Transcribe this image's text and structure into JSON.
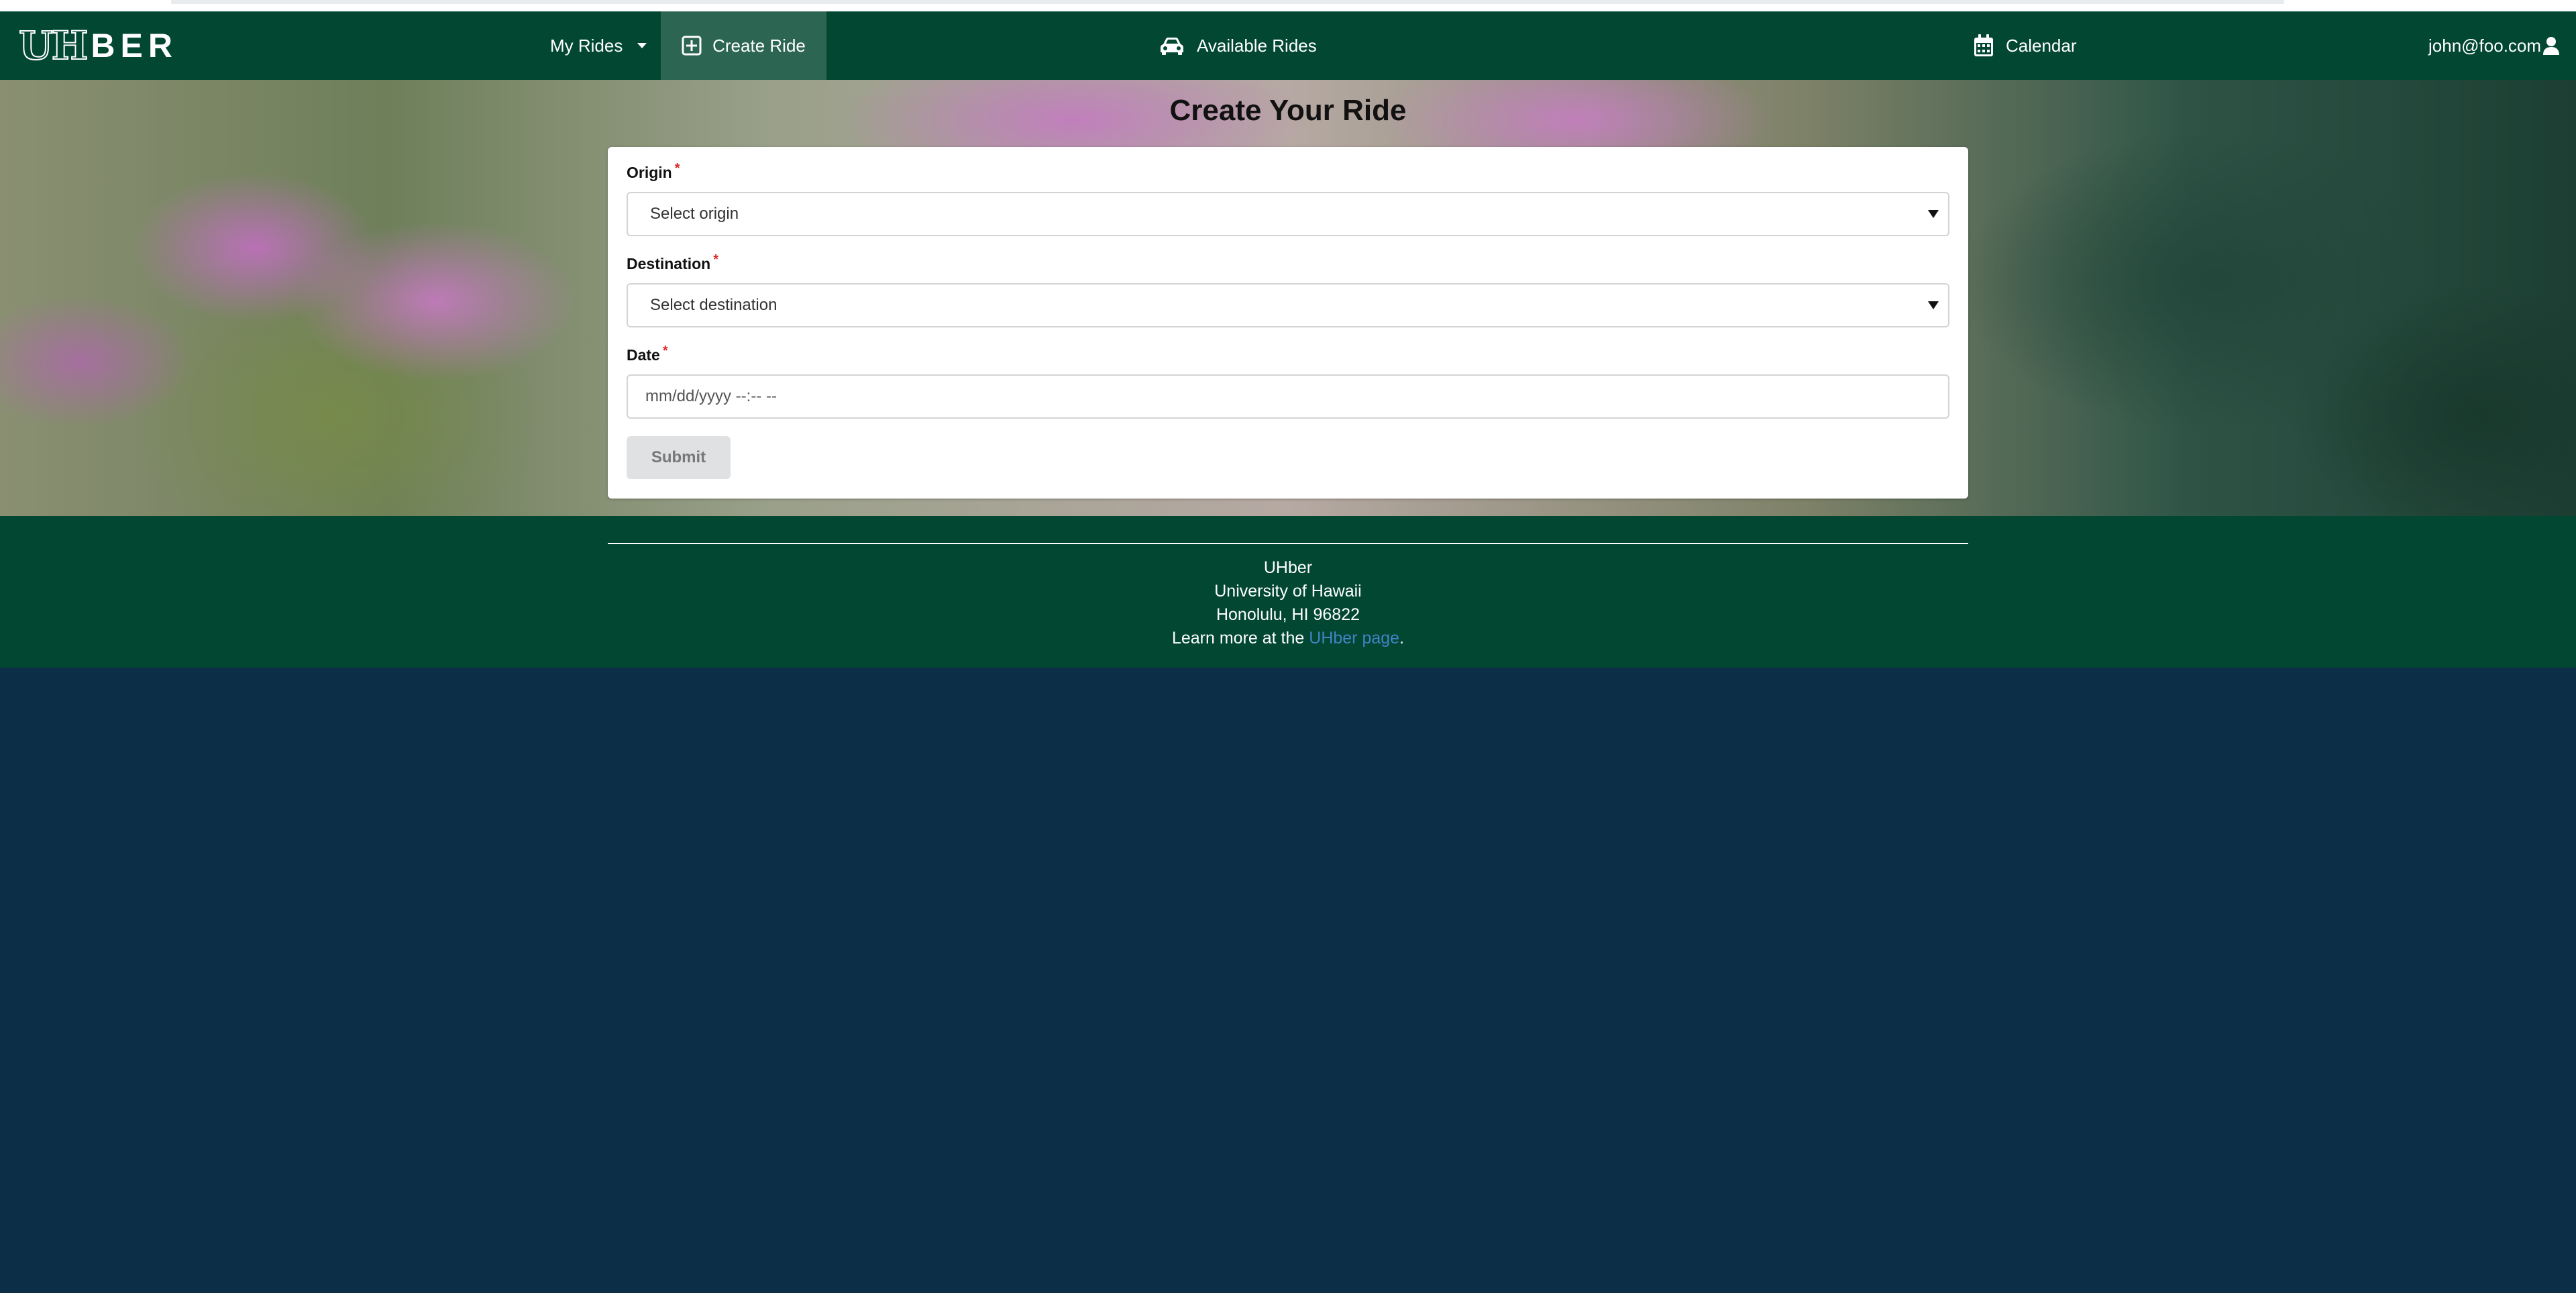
{
  "nav": {
    "brand": {
      "uh": "UH",
      "rest": "BER"
    },
    "my_rides": "My Rides",
    "create_ride": "Create Ride",
    "available_rides": "Available Rides",
    "calendar": "Calendar",
    "user_email": "john@foo.com",
    "icons": {
      "my_rides_dropdown": "caret-down-icon",
      "create_ride": "plus-square-icon",
      "available_rides": "car-icon",
      "calendar": "calendar-icon",
      "user": "user-icon"
    }
  },
  "page": {
    "title": "Create Your Ride"
  },
  "form": {
    "required_mark": "*",
    "origin": {
      "label": "Origin",
      "placeholder": "Select origin"
    },
    "destination": {
      "label": "Destination",
      "placeholder": "Select destination"
    },
    "date": {
      "label": "Date",
      "placeholder": "mm/dd/yyyy --:-- --"
    },
    "submit": "Submit"
  },
  "footer": {
    "line1": "UHber",
    "line2": "University of Hawaii",
    "line3": "Honolulu, HI 96822",
    "learn_prefix": "Learn more at the ",
    "learn_link": "UHber page",
    "learn_suffix": "."
  },
  "colors": {
    "navbar": "#024731",
    "active_nav": "#2c6552",
    "body_background": "#0c2f47",
    "link": "#4183c4",
    "required": "#db2828"
  }
}
